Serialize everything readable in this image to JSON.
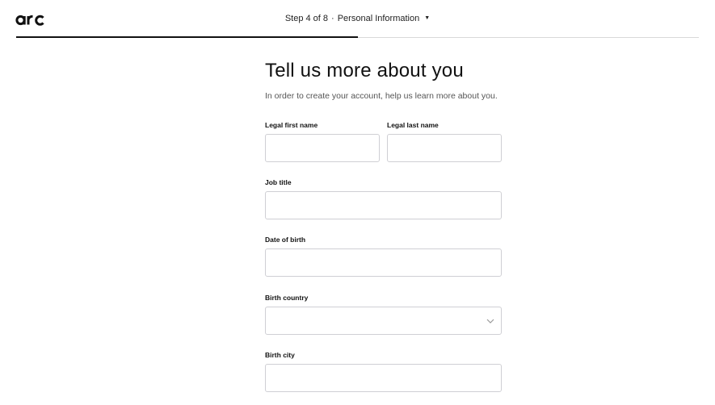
{
  "header": {
    "logo_text": "arc",
    "step_label": "Step 4 of 8",
    "separator": "·",
    "section_label": "Personal Information",
    "dropdown_caret": "▼",
    "progress_fraction": 0.5
  },
  "form": {
    "title": "Tell us more about you",
    "subtitle": "In order to create your account, help us learn more about you.",
    "fields": {
      "first_name": {
        "label": "Legal first name",
        "value": ""
      },
      "last_name": {
        "label": "Legal last name",
        "value": ""
      },
      "job_title": {
        "label": "Job title",
        "value": ""
      },
      "date_of_birth": {
        "label": "Date of birth",
        "value": ""
      },
      "birth_country": {
        "label": "Birth country",
        "value": "",
        "icon": "chevron-down-icon"
      },
      "birth_city": {
        "label": "Birth city",
        "value": ""
      }
    }
  },
  "colors": {
    "border": "#cfcfd4",
    "progress": "#111111",
    "track": "#d9d9d9"
  }
}
